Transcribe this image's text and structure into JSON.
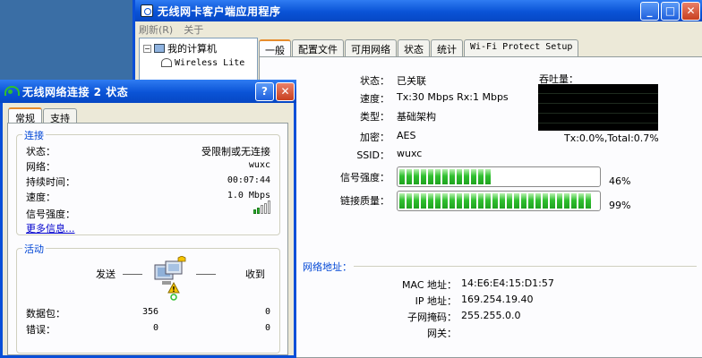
{
  "main_window": {
    "title": "无线网卡客户端应用程序",
    "menu": [
      "刷新(R)",
      "关于"
    ],
    "tree": {
      "root_label": "我的计算机",
      "child_label": "Wireless Lite"
    },
    "tabs": [
      "一般",
      "配置文件",
      "可用网络",
      "状态",
      "统计",
      "Wi-Fi Protect Setup"
    ],
    "general": {
      "status_label": "状态：",
      "status_value": "已关联",
      "speed_label": "速度：",
      "speed_value": "Tx:30 Mbps Rx:1 Mbps",
      "type_label": "类型：",
      "type_value": "基础架构",
      "encryption_label": "加密：",
      "encryption_value": "AES",
      "ssid_label": "SSID：",
      "ssid_value": "wuxc",
      "throughput_label": "吞吐量：",
      "throughput_value": "Tx:0.0%,Total:0.7%",
      "signal_label": "信号强度：",
      "signal_percent": "46%",
      "signal_fraction": 0.46,
      "link_label": "链接质量：",
      "link_percent": "99%",
      "link_fraction": 0.99,
      "network_address_title": "网络地址：",
      "mac_label": "MAC 地址：",
      "mac_value": "14:E6:E4:15:D1:57",
      "ip_label": "IP 地址：",
      "ip_value": "169.254.19.40",
      "subnet_label": "子网掩码：",
      "subnet_value": "255.255.0.0",
      "gateway_label": "网关："
    }
  },
  "status_window": {
    "title": "无线网络连接 2 状态",
    "tabs": [
      "常规",
      "支持"
    ],
    "connection": {
      "group_title": "连接",
      "status_label": "状态：",
      "status_value": "受限制或无连接",
      "network_label": "网络：",
      "network_value": "wuxc",
      "duration_label": "持续时间：",
      "duration_value": "00:07:44",
      "speed_label": "速度：",
      "speed_value": "1.0 Mbps",
      "signal_label": "信号强度：",
      "signal_bars_lit": 2,
      "signal_bars_total": 5,
      "more_info": "更多信息..."
    },
    "activity": {
      "group_title": "活动",
      "sent_label": "发送",
      "received_label": "收到",
      "packets_label": "数据包：",
      "packets_sent": "356",
      "packets_received": "0",
      "errors_label": "错误：",
      "errors_sent": "0",
      "errors_received": "0"
    }
  },
  "colors": {
    "titlebar": "#0a53d6",
    "group_title": "#0046d5",
    "progress_green": "#30c030",
    "warning_yellow": "#f5c400"
  }
}
